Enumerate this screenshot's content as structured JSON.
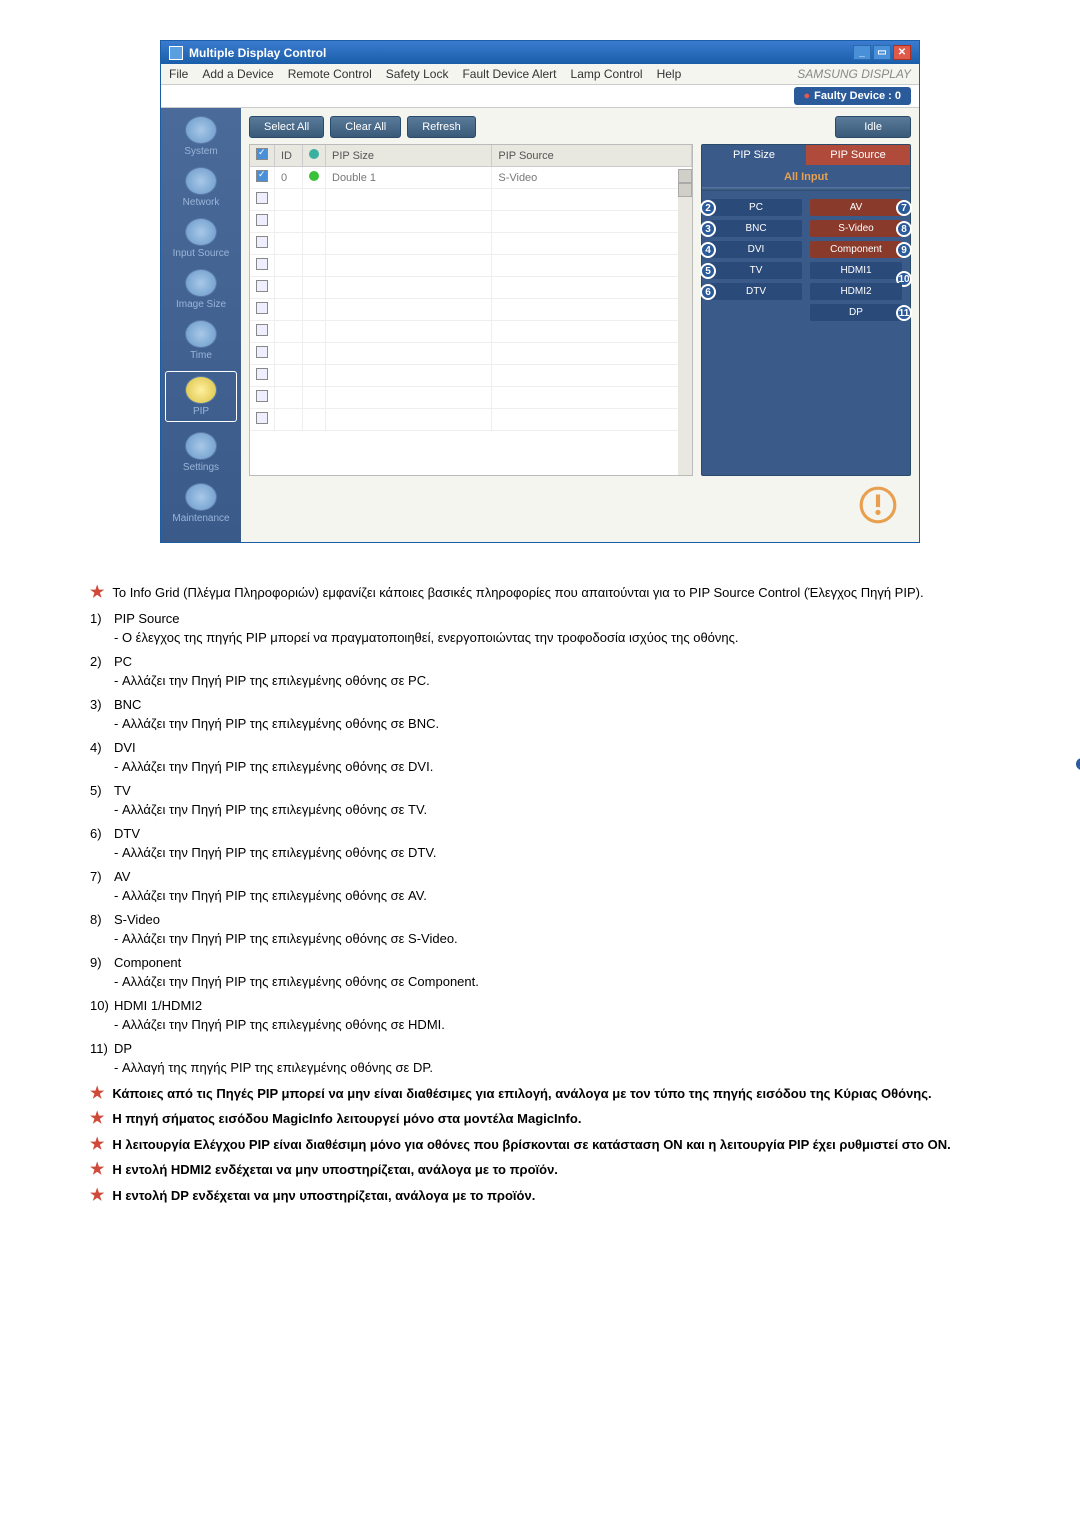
{
  "app": {
    "title": "Multiple Display Control",
    "menus": [
      "File",
      "Add a Device",
      "Remote Control",
      "Safety Lock",
      "Fault Device Alert",
      "Lamp Control",
      "Help"
    ],
    "brand": "SAMSUNG DISPLAY",
    "faulty": "Faulty Device : 0",
    "toolbar": {
      "select_all": "Select All",
      "clear_all": "Clear All",
      "refresh": "Refresh",
      "idle": "Idle"
    },
    "sidebar": [
      "System",
      "Network",
      "Input Source",
      "Image Size",
      "Time",
      "PIP",
      "Settings",
      "Maintenance"
    ],
    "grid": {
      "headers": [
        "",
        "ID",
        "",
        "PIP Size",
        "PIP Source"
      ],
      "row": {
        "id": "0",
        "pip_size": "Double 1",
        "pip_source": "S-Video"
      }
    },
    "right": {
      "tab1": "PIP Size",
      "tab2": "PIP Source",
      "section": "All Input",
      "cells": {
        "pc": "PC",
        "av": "AV",
        "bnc": "BNC",
        "svideo": "S-Video",
        "dvi": "DVI",
        "component": "Component",
        "tv": "TV",
        "hdmi1": "HDMI1",
        "dtv": "DTV",
        "hdmi2": "HDMI2",
        "dp": "DP"
      }
    }
  },
  "notes": {
    "intro": "Το Info Grid (Πλέγμα Πληροφοριών) εμφανίζει κάποιες βασικές πληροφορίες που απαιτούνται για το PIP Source Control (Έλεγχος Πηγή PIP).",
    "list": [
      {
        "n": "1)",
        "title": "PIP Source",
        "desc": "- Ο έλεγχος της πηγής PIP μπορεί να πραγματοποιηθεί, ενεργοποιώντας την τροφοδοσία ισχύος της οθόνης."
      },
      {
        "n": "2)",
        "title": "PC",
        "desc": "- Αλλάζει την Πηγή PIP της επιλεγμένης οθόνης σε PC."
      },
      {
        "n": "3)",
        "title": "BNC",
        "desc": "- Αλλάζει την Πηγή PIP της επιλεγμένης οθόνης σε BNC."
      },
      {
        "n": "4)",
        "title": "DVI",
        "desc": "- Αλλάζει την Πηγή PIP της επιλεγμένης οθόνης σε DVI."
      },
      {
        "n": "5)",
        "title": "TV",
        "desc": "- Αλλάζει την Πηγή PIP της επιλεγμένης οθόνης σε TV."
      },
      {
        "n": "6)",
        "title": "DTV",
        "desc": "- Αλλάζει την Πηγή PIP της επιλεγμένης οθόνης σε DTV."
      },
      {
        "n": "7)",
        "title": "AV",
        "desc": "- Αλλάζει την Πηγή PIP της επιλεγμένης οθόνης σε AV."
      },
      {
        "n": "8)",
        "title": "S-Video",
        "desc": "- Αλλάζει την Πηγή PIP της επιλεγμένης οθόνης σε S-Video."
      },
      {
        "n": "9)",
        "title": "Component",
        "desc": "- Αλλάζει την Πηγή PIP της επιλεγμένης οθόνης σε Component."
      },
      {
        "n": "10)",
        "title": "HDMI 1/HDMI2",
        "desc": "- Αλλάζει την Πηγή PIP της επιλεγμένης οθόνης σε HDMI."
      },
      {
        "n": "11)",
        "title": "DP",
        "desc": "- Αλλαγή της πηγής PIP της επιλεγμένης οθόνης σε DP."
      }
    ],
    "warnings": [
      "Κάποιες από τις Πηγές PIP μπορεί να μην είναι διαθέσιμες για επιλογή, ανάλογα με τον τύπο της πηγής εισόδου της Κύριας Οθόνης.",
      "Η πηγή σήματος εισόδου MagicInfo λειτουργεί μόνο στα μοντέλα MagicInfo.",
      "Η λειτουργία Ελέγχου PIP είναι διαθέσιμη μόνο για οθόνες που βρίσκονται σε κατάσταση ON και η λειτουργία PIP έχει ρυθμιστεί στο ON.",
      "Η εντολή HDMI2 ενδέχεται να μην υποστηρίζεται, ανάλογα με το προϊόν.",
      "Η εντολή DP ενδέχεται να μην υποστηρίζεται, ανάλογα με το προϊόν."
    ]
  }
}
